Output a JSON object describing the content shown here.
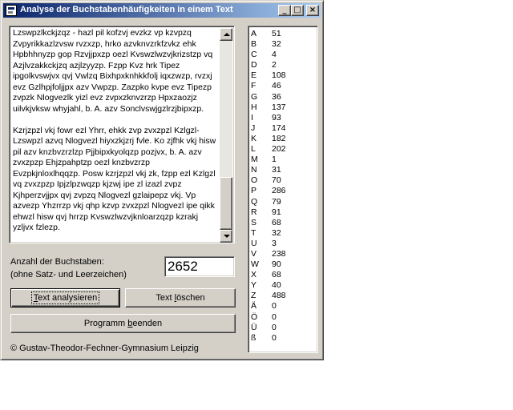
{
  "window": {
    "title": "Analyse der Buchstabenhäufigkeiten in einem Text",
    "minimize_glyph": "_",
    "maximize_glyph": "□",
    "close_glyph": "×"
  },
  "text_input": {
    "value": "Lzswpzlkckjzqz - hazl pil kofzvj evzkz vp kzvpzq Zvpyrikkazlzvsw rvzxzp, hrko azvknvzrkfzvkz ehk Hpbhhnyzp gop Rzvjjpxzp oezl Kvswzlwzvjkrizstzp vq Azjlvzakkckjzq azjlzyyzp. Fzpp Kvz hrk Tipez ipgolkvswjvx qvj Vwlzq Bixhpxknhkkfolj iqxzwzp, rvzxj evz Gzlhpjfoljjpx azv Vwpzp. Zazpko kvpe evz Tipezp zvpzk Nlogvezlk yizl evz zvpxzknvzrzp Hpxzaozjz uilvkjvksw whyjahl, b. A. azv Sonclvswjgzlrzjbipxzp.\n\nKzrjzpzl vkj fowr ezl Yhrr, ehkk zvp zvxzpzl Kzlgzl-Lzswpzl azvq Nlogvezl hiyxzkjzrj fvle. Ko zjfhk vkj hisw pil azv knzbvzrzlzp Pjjbipxkyolqzp pozjvx, b. A. azv zvxzpzp Ehjzpahptzp oezl knzbvzrzp Evzpkjnloxlhqqzp. Posw kzrjzpzl vkj zk, fzpp ezl Kzlgzl vq zvxzpzp Ipjzlpzwqzp kjzwj ipe zl izazl zvpz Kjhperzvjjpx qvj zvpzq Nlogvezl gzlaipepz vkj. Vp azvezp Yhzrrzp vkj qhp kzvp zvxzpzl Nlogvezl ipe qikk ehwzl hisw qvj hrrzp Kvswzlwzvjknloarzqzp kzrakj yzljvx fzlezp."
  },
  "count": {
    "label_line1": "Anzahl der Buchstaben:",
    "label_line2": "(ohne Satz- und Leerzeichen)",
    "value": "2652"
  },
  "buttons": {
    "analyze_u": "T",
    "analyze_rest": "ext analysieren",
    "clear_pre": "Text ",
    "clear_u": "l",
    "clear_rest": "öschen",
    "exit_pre": "Programm ",
    "exit_u": "b",
    "exit_rest": "eenden"
  },
  "copyright": "©  Gustav-Theodor-Fechner-Gymnasium Leipzig",
  "frequencies": [
    {
      "letter": "A",
      "count": "51"
    },
    {
      "letter": "B",
      "count": "32"
    },
    {
      "letter": "C",
      "count": "4"
    },
    {
      "letter": "D",
      "count": "2"
    },
    {
      "letter": "E",
      "count": "108"
    },
    {
      "letter": "F",
      "count": "46"
    },
    {
      "letter": "G",
      "count": "36"
    },
    {
      "letter": "H",
      "count": "137"
    },
    {
      "letter": "I",
      "count": "93"
    },
    {
      "letter": "J",
      "count": "174"
    },
    {
      "letter": "K",
      "count": "182"
    },
    {
      "letter": "L",
      "count": "202"
    },
    {
      "letter": "M",
      "count": "1"
    },
    {
      "letter": "N",
      "count": "31"
    },
    {
      "letter": "O",
      "count": "70"
    },
    {
      "letter": "P",
      "count": "286"
    },
    {
      "letter": "Q",
      "count": "79"
    },
    {
      "letter": "R",
      "count": "91"
    },
    {
      "letter": "S",
      "count": "68"
    },
    {
      "letter": "T",
      "count": "32"
    },
    {
      "letter": "U",
      "count": "3"
    },
    {
      "letter": "V",
      "count": "238"
    },
    {
      "letter": "W",
      "count": "90"
    },
    {
      "letter": "X",
      "count": "68"
    },
    {
      "letter": "Y",
      "count": "40"
    },
    {
      "letter": "Z",
      "count": "488"
    },
    {
      "letter": "Ä",
      "count": "0"
    },
    {
      "letter": "Ö",
      "count": "0"
    },
    {
      "letter": "Ü",
      "count": "0"
    },
    {
      "letter": "ß",
      "count": "0"
    }
  ]
}
